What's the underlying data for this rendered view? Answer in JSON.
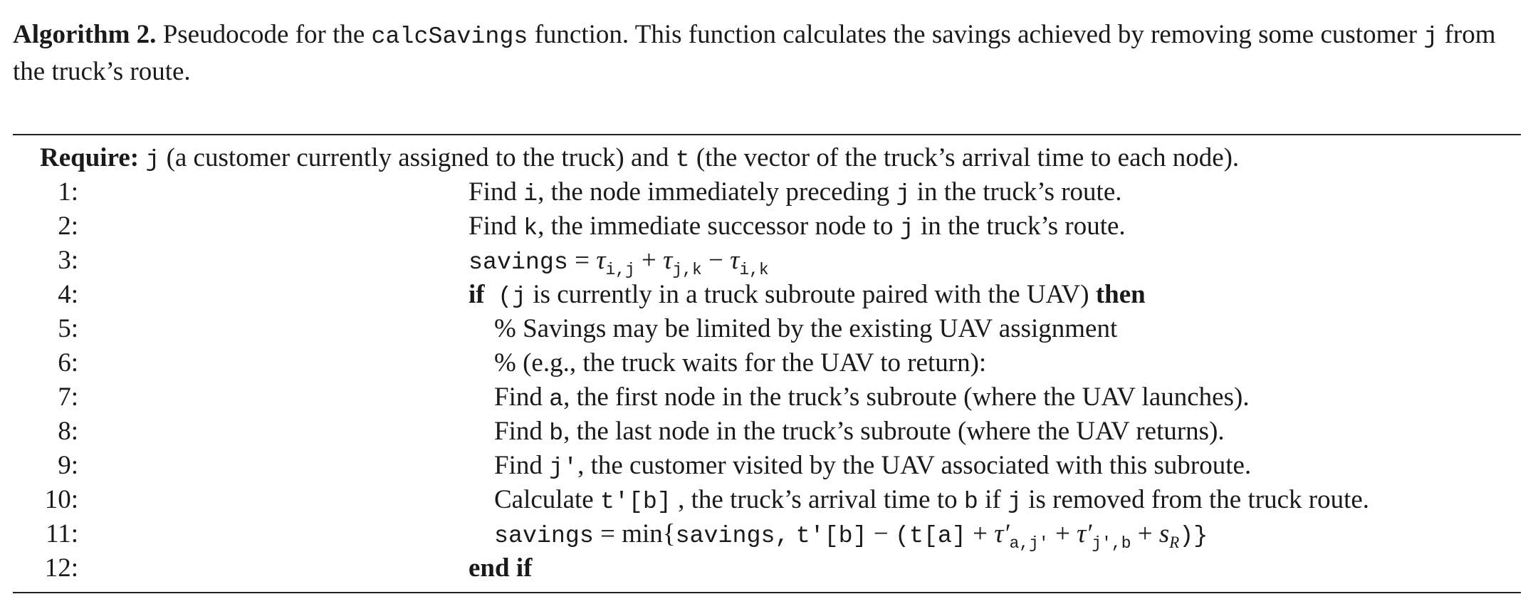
{
  "caption": {
    "label": "Algorithm 2.",
    "text_before": "Pseudocode for the",
    "function_name": "calcSavings",
    "text_mid": "function. This function calculates the savings achieved by removing some customer",
    "var_j": "j",
    "text_after": "from the truck’s route."
  },
  "require": {
    "keyword": "Require:",
    "j": "j",
    "text1": "(a customer currently assigned to the truck) and",
    "t": "t",
    "text2": "(the vector of the truck’s arrival time to each node)."
  },
  "lines": [
    {
      "num": "1:",
      "p1": "Find",
      "v1": "i",
      "p2": ", the node immediately preceding",
      "v2": "j",
      "p3": "in the truck’s route."
    },
    {
      "num": "2:",
      "p1": "Find",
      "v1": "k",
      "p2": ", the immediate successor node to",
      "v2": "j",
      "p3": "in the truck’s route."
    },
    {
      "num": "3:",
      "lhs": "savings",
      "eq": "=",
      "tau": "τ",
      "s1": "i,j",
      "plus": "+",
      "s2": "j,k",
      "minus": "−",
      "s3": "i,k"
    },
    {
      "num": "4:",
      "kw_if": "if",
      "paren": "(",
      "v1": "j",
      "text": "is currently in a truck subroute paired with the UAV)",
      "kw_then": "then"
    },
    {
      "num": "5:",
      "text": "% Savings may be limited by the existing UAV assignment"
    },
    {
      "num": "6:",
      "text": "% (e.g., the truck waits for the UAV to return):"
    },
    {
      "num": "7:",
      "p1": "Find",
      "v1": "a",
      "p2": ", the first node in the truck’s subroute (where the UAV launches)."
    },
    {
      "num": "8:",
      "p1": "Find",
      "v1": "b",
      "p2": ", the last node in the truck’s subroute (where the UAV returns)."
    },
    {
      "num": "9:",
      "p1": "Find",
      "v1": "j′",
      "p2": ", the customer visited by the UAV associated with this subroute."
    },
    {
      "num": "10:",
      "p1": "Calculate",
      "v1": "t′[b]",
      "p2": ", the truck’s arrival time to",
      "v2": "b",
      "p3": "if",
      "v3": "j",
      "p4": "is removed from the truck route."
    },
    {
      "num": "11:",
      "lhs": "savings",
      "eq": "=",
      "min": "min{",
      "arg1": "savings,",
      "t_prime": "t′[b]",
      "minus": "−",
      "open": "(t[a]",
      "plus1": "+",
      "tau1": "τ′",
      "sub1": "a,j′",
      "plus2": "+",
      "tau2": "τ′",
      "sub2": "j′,b",
      "plus3": "+",
      "sR": "s",
      "sRsub": "R",
      "close": ")}"
    },
    {
      "num": "12:",
      "kw": "end if"
    }
  ]
}
